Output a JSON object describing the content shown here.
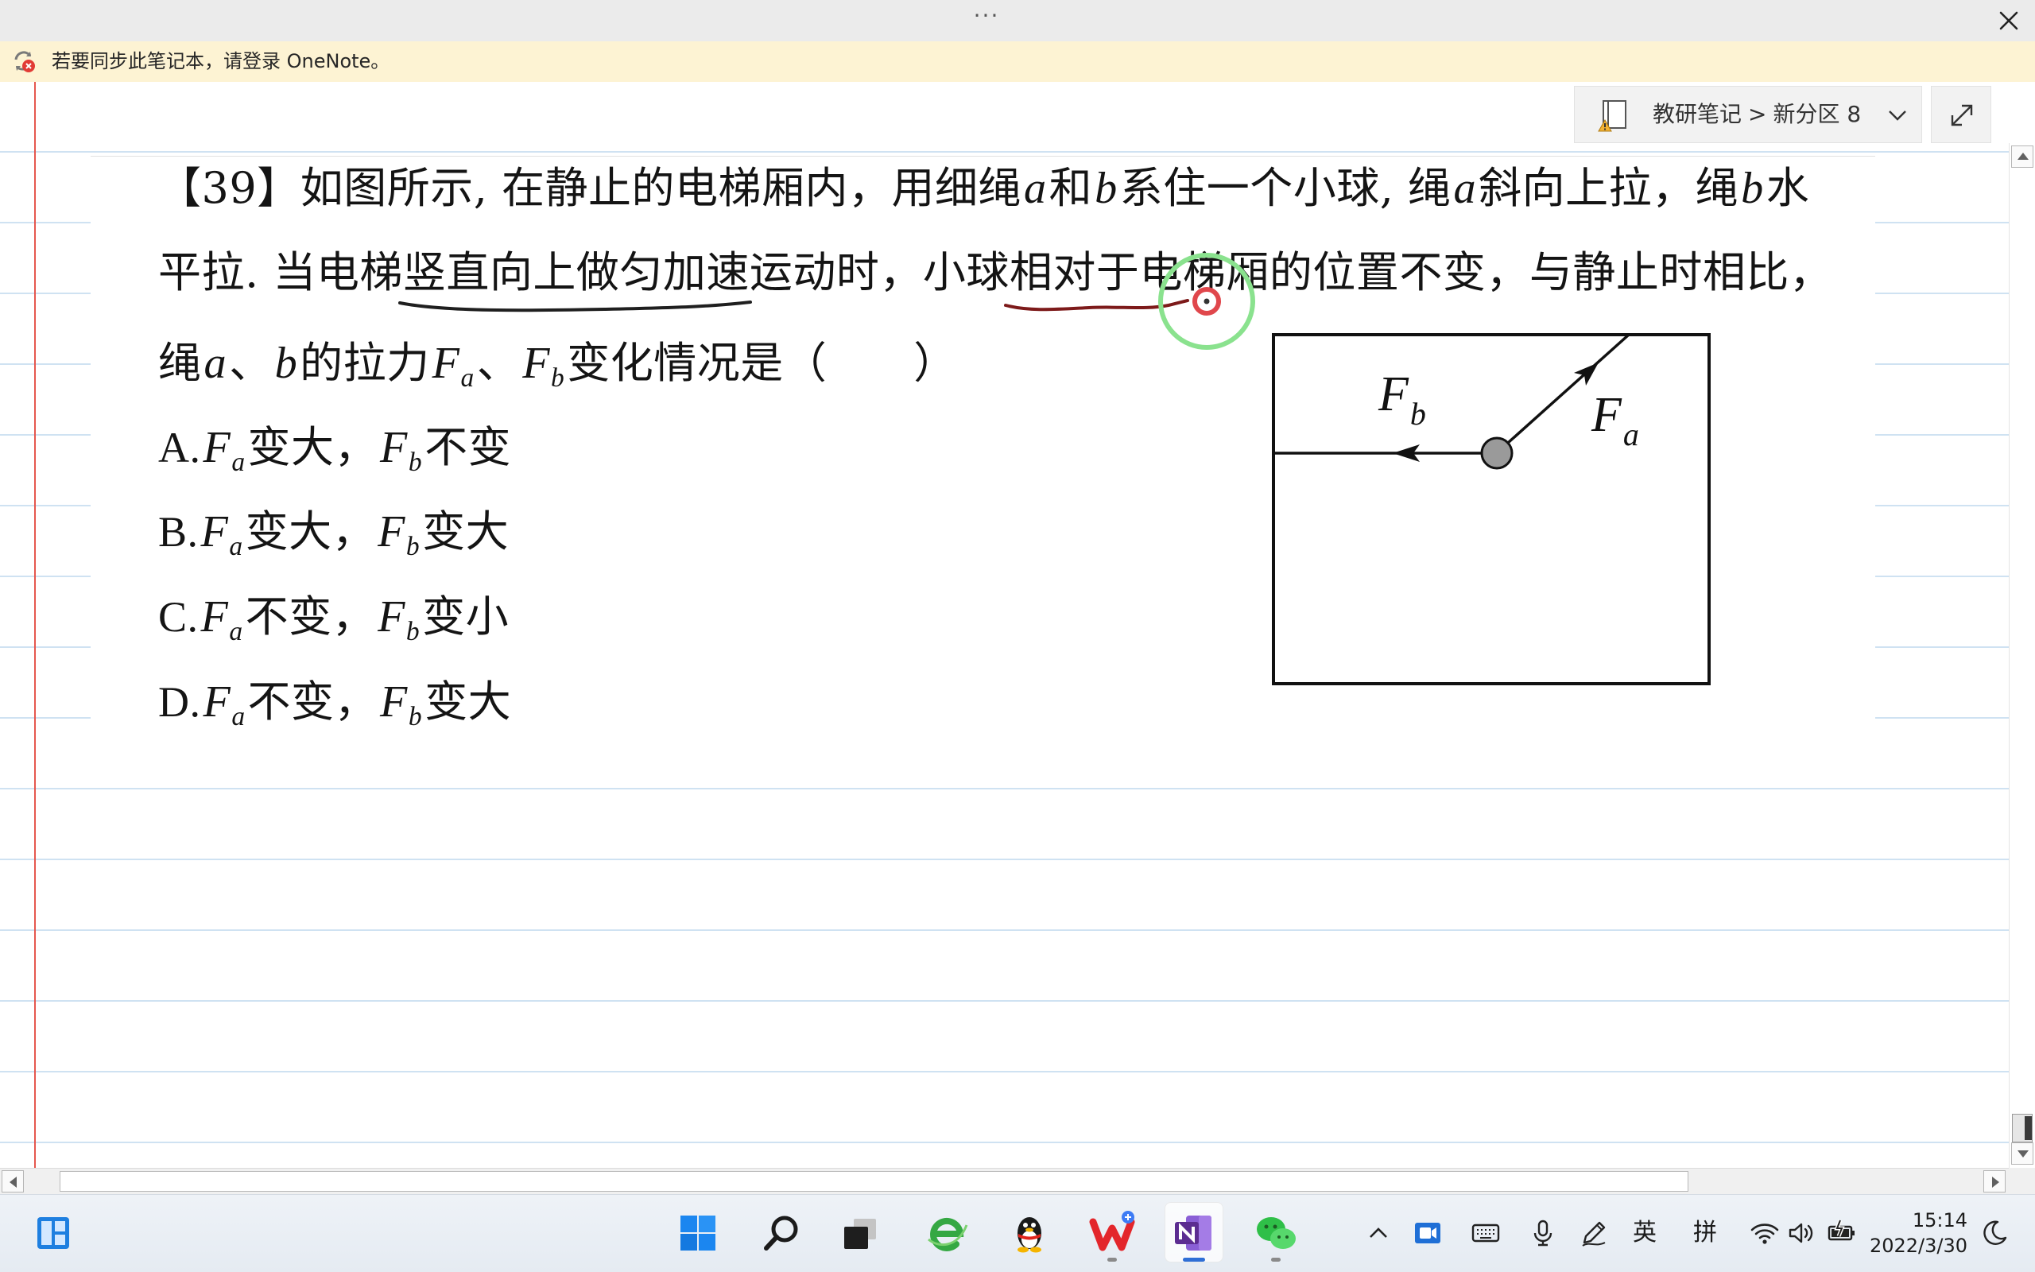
{
  "window": {
    "more_glyph": "···",
    "close_icon": "close-icon"
  },
  "notification": {
    "text": "若要同步此笔记本，请登录 OneNote。",
    "icon": "sync-error-icon"
  },
  "breadcrumb": {
    "notebook": "教研笔记",
    "separator": ">",
    "section": "新分区 8",
    "icon": "notebook-warning-icon",
    "dropdown_icon": "chevron-down-icon",
    "expand_icon": "expand-icon"
  },
  "question": {
    "lines": [
      [
        {
          "t": "【39】如图所示, 在静止的电梯厢内，用细绳"
        },
        {
          "t": "a",
          "k": "v"
        },
        {
          "t": "和"
        },
        {
          "t": "b",
          "k": "v"
        },
        {
          "t": "系住一个小球, 绳"
        },
        {
          "t": "a",
          "k": "v"
        },
        {
          "t": "斜向上拉，绳"
        },
        {
          "t": "b",
          "k": "v"
        },
        {
          "t": "水"
        }
      ],
      [
        {
          "t": "平拉. 当电梯竖直向上做匀加速运动时，小球相对于电梯厢的位置不变，与静止时相比，"
        }
      ],
      [
        {
          "t": "绳"
        },
        {
          "t": "a",
          "k": "v"
        },
        {
          "t": "、"
        },
        {
          "t": "b",
          "k": "v"
        },
        {
          "t": "的拉力"
        },
        {
          "t": "F",
          "k": "v"
        },
        {
          "t": "a",
          "k": "s"
        },
        {
          "t": "、"
        },
        {
          "t": "F",
          "k": "v"
        },
        {
          "t": "b",
          "k": "s"
        },
        {
          "t": "变化情况是（　　）"
        }
      ]
    ],
    "options": [
      [
        {
          "t": "A."
        },
        {
          "t": "F",
          "k": "v"
        },
        {
          "t": "a",
          "k": "s"
        },
        {
          "t": "变大，"
        },
        {
          "t": "F",
          "k": "v"
        },
        {
          "t": "b",
          "k": "s"
        },
        {
          "t": "不变"
        }
      ],
      [
        {
          "t": "B."
        },
        {
          "t": "F",
          "k": "v"
        },
        {
          "t": "a",
          "k": "s"
        },
        {
          "t": "变大，"
        },
        {
          "t": "F",
          "k": "v"
        },
        {
          "t": "b",
          "k": "s"
        },
        {
          "t": "变大"
        }
      ],
      [
        {
          "t": "C."
        },
        {
          "t": "F",
          "k": "v"
        },
        {
          "t": "a",
          "k": "s"
        },
        {
          "t": "不变，"
        },
        {
          "t": "F",
          "k": "v"
        },
        {
          "t": "b",
          "k": "s"
        },
        {
          "t": "变小"
        }
      ],
      [
        {
          "t": "D."
        },
        {
          "t": "F",
          "k": "v"
        },
        {
          "t": "a",
          "k": "s"
        },
        {
          "t": "不变，"
        },
        {
          "t": "F",
          "k": "v"
        },
        {
          "t": "b",
          "k": "s"
        },
        {
          "t": "变大"
        }
      ]
    ]
  },
  "diagram": {
    "label_b": {
      "main": "F",
      "sub": "b"
    },
    "label_a": {
      "main": "F",
      "sub": "a"
    }
  },
  "taskbar": {
    "left_icon": "widgets-icon",
    "apps": [
      {
        "icon": "windows-logo-icon",
        "running": false,
        "active": false
      },
      {
        "icon": "search-icon",
        "running": false,
        "active": false
      },
      {
        "icon": "task-view-icon",
        "running": false,
        "active": false
      },
      {
        "icon": "browser-icon",
        "running": false,
        "active": false
      },
      {
        "icon": "qq-icon",
        "running": false,
        "active": false
      },
      {
        "icon": "wps-icon",
        "running": true,
        "active": false
      },
      {
        "icon": "onenote-icon",
        "running": true,
        "active": true
      },
      {
        "icon": "wechat-icon",
        "running": true,
        "active": false
      }
    ],
    "tray": {
      "icons": [
        "chevron-up-icon",
        "screen-record-icon",
        "keyboard-icon",
        "microphone-icon",
        "pen-icon",
        "wifi-icon",
        "volume-icon",
        "battery-icon",
        "moon-icon"
      ],
      "ime_language": "英",
      "ime_mode": "拼"
    },
    "clock": {
      "time": "15:14",
      "date": "2022/3/30"
    }
  },
  "colors": {
    "notification_bg": "#fdf3d3",
    "ruled_line": "#cfe2f2",
    "margin_line": "#e5574e",
    "ink_black": "#1f1f1f",
    "ink_red": "#7d1a1a",
    "cursor_ring": "#8ae28e",
    "cursor_dot": "#e0474c",
    "taskbar_active": "#2f6fd6"
  }
}
